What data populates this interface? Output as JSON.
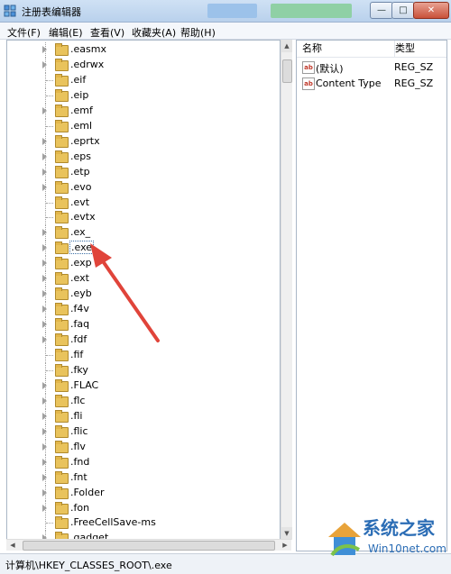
{
  "window": {
    "title": "注册表编辑器"
  },
  "menu": [
    "文件(F)",
    "编辑(E)",
    "查看(V)",
    "收藏夹(A)",
    "帮助(H)"
  ],
  "window_buttons": {
    "minimize": "—",
    "maximize": "□",
    "close": "✕"
  },
  "tree": {
    "items": [
      {
        "label": ".easmx",
        "expandable": true
      },
      {
        "label": ".edrwx",
        "expandable": true
      },
      {
        "label": ".eif",
        "expandable": false
      },
      {
        "label": ".eip",
        "expandable": false
      },
      {
        "label": ".emf",
        "expandable": true
      },
      {
        "label": ".eml",
        "expandable": false
      },
      {
        "label": ".eprtx",
        "expandable": true
      },
      {
        "label": ".eps",
        "expandable": true
      },
      {
        "label": ".etp",
        "expandable": true
      },
      {
        "label": ".evo",
        "expandable": true
      },
      {
        "label": ".evt",
        "expandable": false
      },
      {
        "label": ".evtx",
        "expandable": false
      },
      {
        "label": ".ex_",
        "expandable": true
      },
      {
        "label": ".exe",
        "expandable": true,
        "selected": true
      },
      {
        "label": ".exp",
        "expandable": true
      },
      {
        "label": ".ext",
        "expandable": true
      },
      {
        "label": ".eyb",
        "expandable": true
      },
      {
        "label": ".f4v",
        "expandable": true
      },
      {
        "label": ".faq",
        "expandable": true
      },
      {
        "label": ".fdf",
        "expandable": true
      },
      {
        "label": ".fif",
        "expandable": false
      },
      {
        "label": ".fky",
        "expandable": false
      },
      {
        "label": ".FLAC",
        "expandable": true
      },
      {
        "label": ".flc",
        "expandable": true
      },
      {
        "label": ".fli",
        "expandable": true
      },
      {
        "label": ".flic",
        "expandable": true
      },
      {
        "label": ".flv",
        "expandable": true
      },
      {
        "label": ".fnd",
        "expandable": true
      },
      {
        "label": ".fnt",
        "expandable": true
      },
      {
        "label": ".Folder",
        "expandable": true
      },
      {
        "label": ".fon",
        "expandable": true
      },
      {
        "label": ".FreeCellSave-ms",
        "expandable": false
      },
      {
        "label": ".gadget",
        "expandable": true
      }
    ]
  },
  "values_pane": {
    "columns": {
      "name": "名称",
      "type": "类型"
    },
    "rows": [
      {
        "icon": "ab",
        "name": "(默认)",
        "type": "REG_SZ"
      },
      {
        "icon": "ab",
        "name": "Content Type",
        "type": "REG_SZ"
      }
    ]
  },
  "status": {
    "path": "计算机\\HKEY_CLASSES_ROOT\\.exe"
  },
  "watermark": {
    "cn": "系统之家",
    "en": "Win10net.com"
  },
  "colors": {
    "accent_arrow": "#e0443a",
    "watermark": "#2b6db5"
  }
}
